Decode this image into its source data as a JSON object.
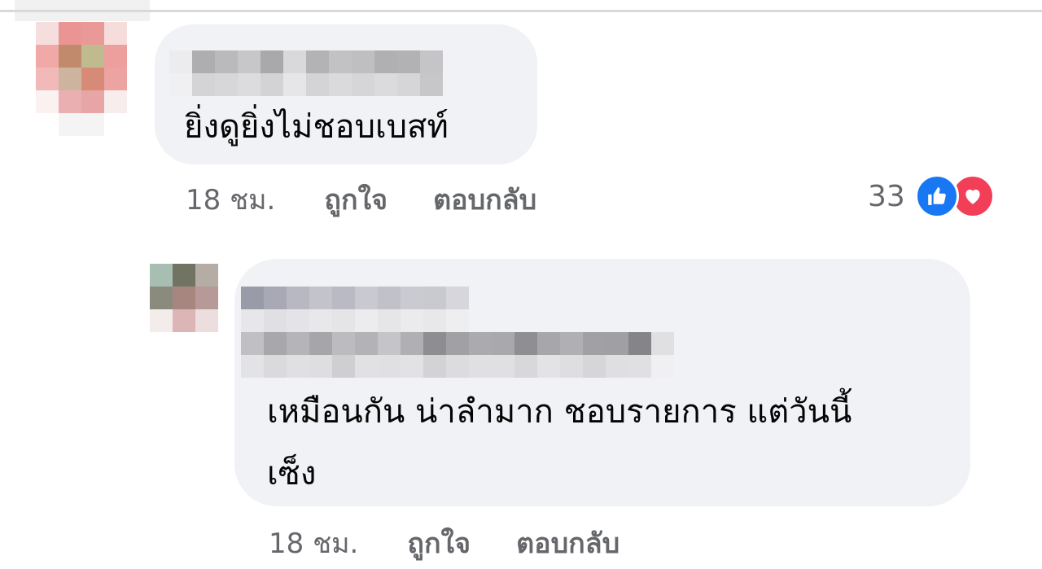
{
  "comments": [
    {
      "text": "ยิ่งดูยิ่งไม่ชอบเบสท์",
      "time": "18 ชม.",
      "like_label": "ถูกใจ",
      "reply_label": "ตอบกลับ",
      "reaction_count": "33",
      "reaction_icons": [
        "like-icon",
        "love-icon"
      ]
    },
    {
      "text_line1": "เหมือนกัน น่าลำมาก ชอบรายการ แต่วันนี้",
      "text_line2": "เซ็ง",
      "time": "18 ชม.",
      "like_label": "ถูกใจ",
      "reply_label": "ตอบกลับ"
    }
  ],
  "colors": {
    "bubble": "#f0f2f5",
    "meta_text": "#65676b",
    "like_blue": "#1877f2",
    "love_red": "#f33e58"
  }
}
